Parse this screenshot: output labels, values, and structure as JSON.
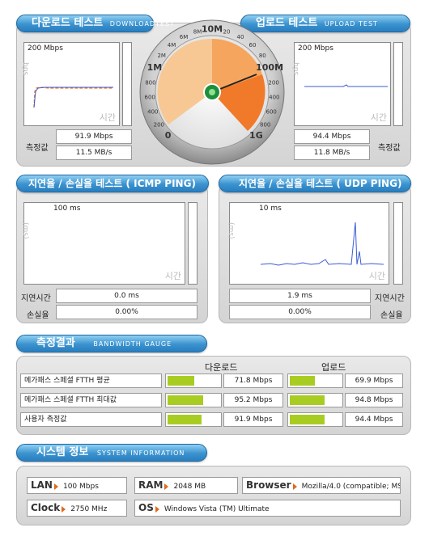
{
  "download": {
    "header": "다운로드 테스트",
    "header_sub": "DOWNLOADTEST",
    "graph_top": "200 Mbps",
    "graph_ylabel": "bps",
    "graph_time": "시간",
    "value_mbps": "91.9 Mbps",
    "value_mbs": "11.5 MB/s",
    "label": "측정값"
  },
  "upload": {
    "header": "업로드 테스트",
    "header_sub": "UPLOAD TEST",
    "graph_top": "200 Mbps",
    "graph_ylabel": "bps",
    "graph_time": "시간",
    "value_mbps": "94.4 Mbps",
    "value_mbs": "11.8 MB/s",
    "label": "측정값"
  },
  "gauge": {
    "ticks": [
      "0",
      "200",
      "400",
      "600",
      "800",
      "1M",
      "2M",
      "4M",
      "6M",
      "8M",
      "10M",
      "20",
      "40",
      "60",
      "80",
      "100M",
      "200",
      "400",
      "600",
      "800",
      "1G"
    ]
  },
  "icmp": {
    "header": "지연율 / 손실율 테스트 ( ICMP PING)",
    "graph_top": "100 ms",
    "graph_ylabel": "(ms)",
    "graph_time": "시간",
    "delay_label": "지연시간",
    "loss_label": "손실율",
    "delay": "0.0 ms",
    "loss": "0.00%"
  },
  "udp": {
    "header": "지연율 / 손실율 테스트 ( UDP PING)",
    "graph_top": "10 ms",
    "graph_ylabel": "(ms)",
    "graph_time": "시간",
    "delay_label": "지연시간",
    "loss_label": "손실율",
    "delay": "1.9 ms",
    "loss": "0.00%"
  },
  "results": {
    "header": "측정결과",
    "header_sub": "BANDWIDTH GAUGE",
    "col_download": "다운로드",
    "col_upload": "업로드",
    "rows": [
      {
        "label": "메가패스 스페셜 FTTH 평균",
        "down": "71.8 Mbps",
        "down_pct": 0.48,
        "up": "69.9 Mbps",
        "up_pct": 0.47
      },
      {
        "label": "메가패스 스페셜 FTTH 최대값",
        "down": "95.2 Mbps",
        "down_pct": 0.64,
        "up": "94.8 Mbps",
        "up_pct": 0.64
      },
      {
        "label": "사용자 측정값",
        "down": "91.9 Mbps",
        "down_pct": 0.62,
        "up": "94.4 Mbps",
        "up_pct": 0.64
      }
    ]
  },
  "system": {
    "header": "시스템 정보",
    "header_sub": "SYSTEM INFORMATION",
    "lan_label": "LAN",
    "lan": "100 Mbps",
    "ram_label": "RAM",
    "ram": "2048 MB",
    "browser_label": "Browser",
    "browser": "Mozilla/4.0 (compatible; MS",
    "clock_label": "Clock",
    "clock": "2750 MHz",
    "os_label": "OS",
    "os": "Windows Vista (TM) Ultimate"
  },
  "colors": {
    "accent": "#3a92cf",
    "bar": "#a8cc22",
    "gauge_orange": "#f07a2a",
    "graph_line": "#3b5bd6"
  }
}
